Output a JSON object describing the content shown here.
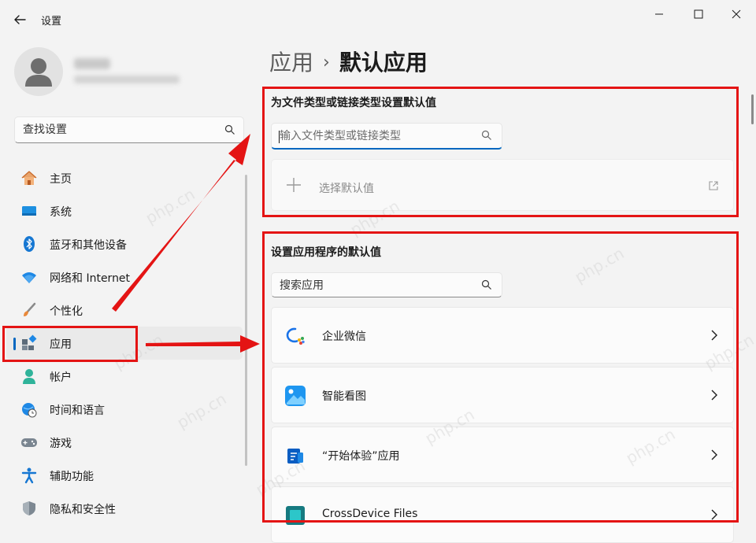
{
  "window": {
    "title": "设置",
    "back_icon": "back-arrow-icon",
    "controls": [
      "minimize-icon",
      "maximize-icon",
      "close-icon"
    ]
  },
  "sidebar": {
    "user": {
      "avatar_icon": "person-icon"
    },
    "search": {
      "placeholder": "查找设置",
      "icon": "search-icon"
    },
    "items": [
      {
        "label": "主页",
        "icon": "home-icon",
        "active": false
      },
      {
        "label": "系统",
        "icon": "monitor-icon",
        "active": false
      },
      {
        "label": "蓝牙和其他设备",
        "icon": "bluetooth-icon",
        "active": false
      },
      {
        "label": "网络和 Internet",
        "icon": "wifi-icon",
        "active": false
      },
      {
        "label": "个性化",
        "icon": "paintbrush-icon",
        "active": false
      },
      {
        "label": "应用",
        "icon": "apps-icon",
        "active": true
      },
      {
        "label": "帐户",
        "icon": "account-icon",
        "active": false
      },
      {
        "label": "时间和语言",
        "icon": "globe-clock-icon",
        "active": false
      },
      {
        "label": "游戏",
        "icon": "gamepad-icon",
        "active": false
      },
      {
        "label": "辅助功能",
        "icon": "accessibility-icon",
        "active": false
      },
      {
        "label": "隐私和安全性",
        "icon": "shield-icon",
        "active": false
      }
    ]
  },
  "main": {
    "breadcrumb": {
      "parent": "应用",
      "separator": "›",
      "current": "默认应用"
    },
    "file_types": {
      "title": "为文件类型或链接类型设置默认值",
      "search_placeholder": "输入文件类型或链接类型",
      "choose_label": "选择默认值"
    },
    "apps": {
      "title": "设置应用程序的默认值",
      "search_placeholder": "搜索应用",
      "list": [
        {
          "name": "企业微信",
          "icon": "wecom-icon"
        },
        {
          "name": "智能看图",
          "icon": "image-viewer-icon"
        },
        {
          "name": "“开始体验”应用",
          "icon": "get-started-icon"
        },
        {
          "name": "CrossDevice Files",
          "icon": "crossdevice-icon"
        }
      ]
    }
  },
  "annotation": {
    "color": "#e41414",
    "watermark": "php.cn"
  },
  "colors": {
    "accent": "#0067c0",
    "background": "#f3f3f3",
    "card": "#fbfbfb"
  }
}
